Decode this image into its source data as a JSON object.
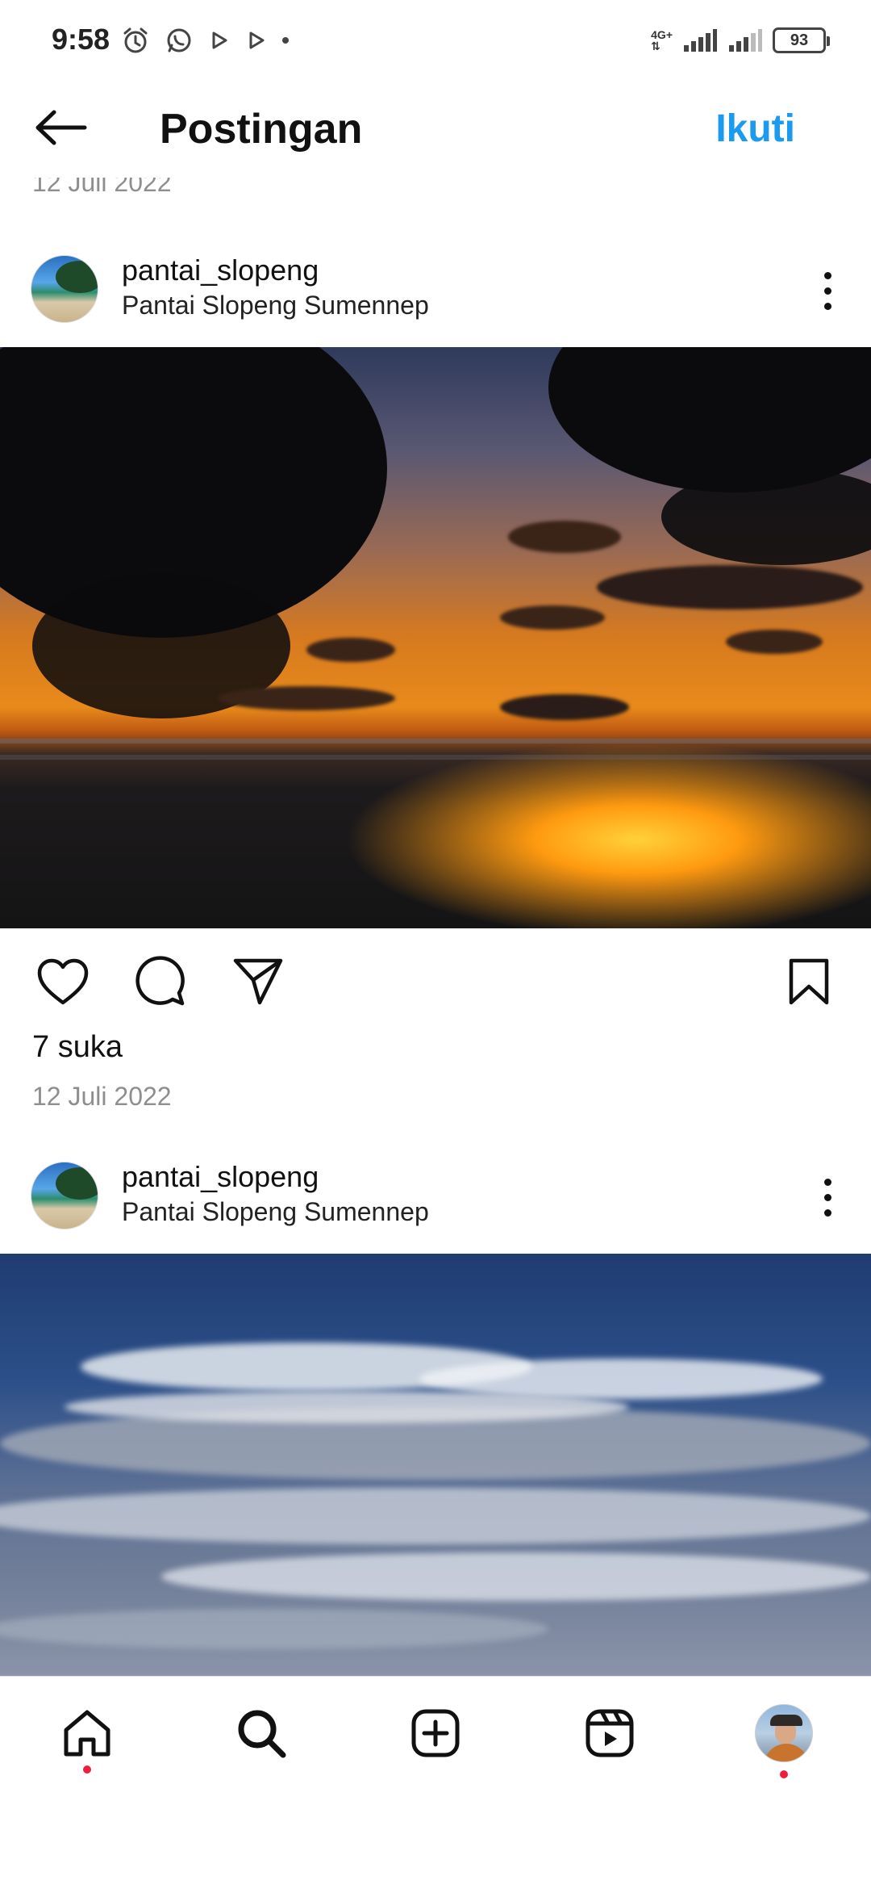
{
  "status_bar": {
    "time": "9:58",
    "network_type": "4G+",
    "battery": "93"
  },
  "header": {
    "title": "Postingan",
    "follow_label": "Ikuti"
  },
  "clipped_previous_date": "12 Juli 2022",
  "posts": [
    {
      "username": "pantai_slopeng",
      "location": "Pantai Slopeng Sumennep",
      "likes": "7 suka",
      "date": "12 Juli 2022"
    },
    {
      "username": "pantai_slopeng",
      "location": "Pantai Slopeng Sumennep"
    }
  ],
  "colors": {
    "accent": "#1a9bf0",
    "notification_dot": "#f01e3c"
  },
  "icons": {
    "header": [
      "back-arrow-icon",
      "more-options-icon"
    ],
    "actions": [
      "heart-icon",
      "comment-icon",
      "share-icon",
      "bookmark-icon"
    ],
    "nav": [
      "home-icon",
      "search-icon",
      "add-post-icon",
      "reels-icon",
      "profile-avatar"
    ]
  }
}
